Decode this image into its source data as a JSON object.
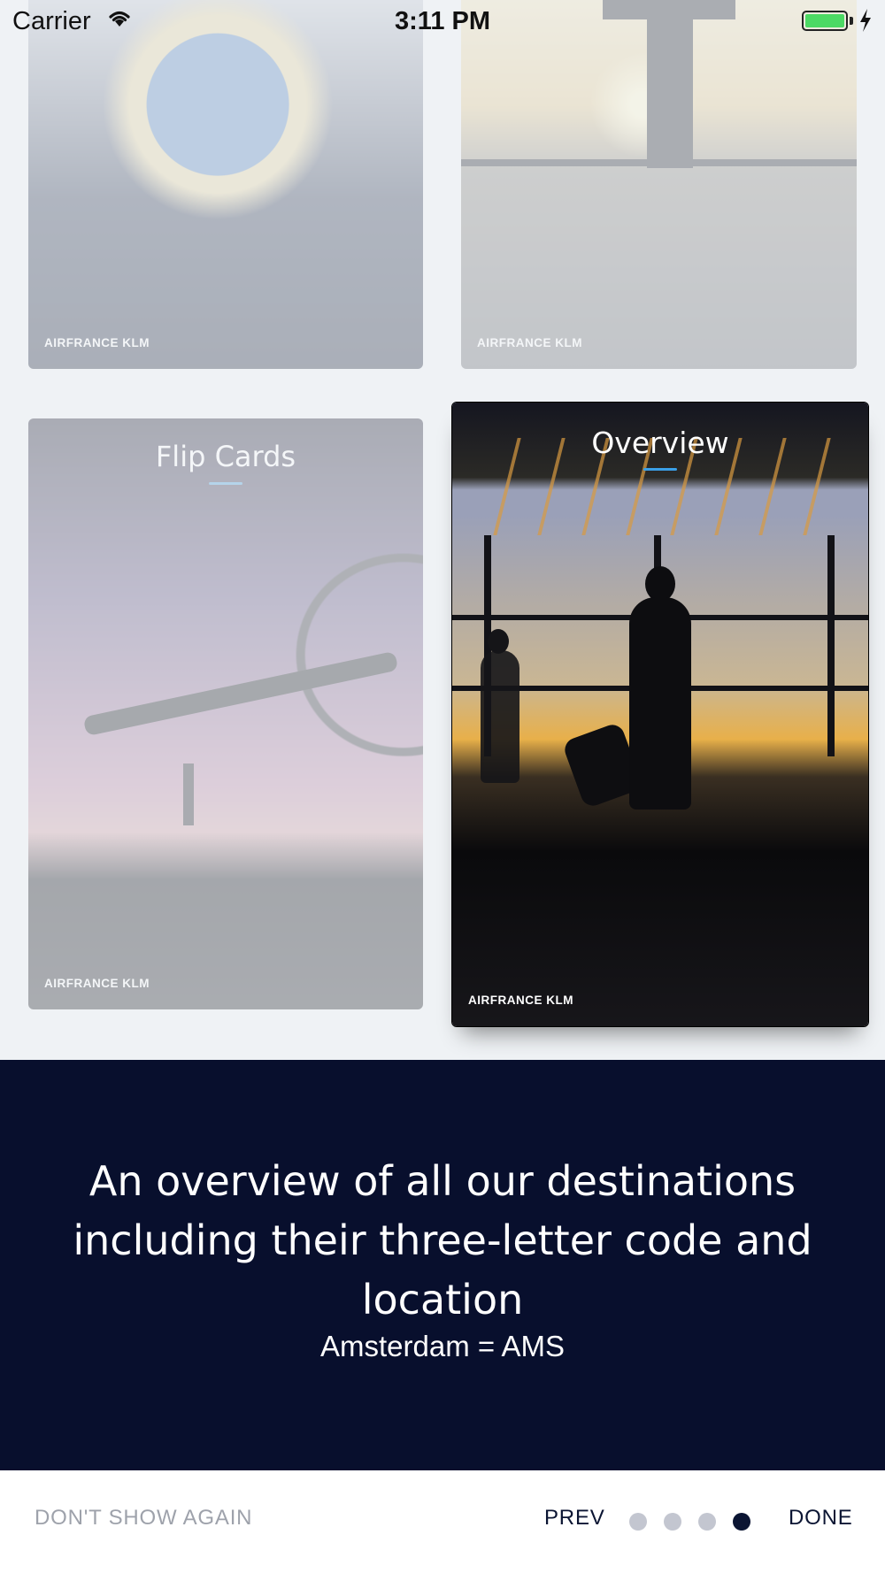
{
  "status_bar": {
    "carrier": "Carrier",
    "time": "3:11 PM",
    "battery_color": "#4cd964"
  },
  "cards": [
    {
      "title": "",
      "brand": "AIRFRANCE KLM",
      "active": false
    },
    {
      "title": "",
      "brand": "AIRFRANCE KLM",
      "active": false
    },
    {
      "title": "Flip Cards",
      "brand": "AIRFRANCE KLM",
      "active": false
    },
    {
      "title": "Overview",
      "brand": "AIRFRANCE KLM",
      "active": true
    }
  ],
  "info": {
    "headline": "An overview of all our destinations including their three-letter code and location",
    "subline": "Amsterdam = AMS"
  },
  "footer": {
    "dont_show_label": "DON'T SHOW AGAIN",
    "prev_label": "PREV",
    "done_label": "DONE",
    "page_count": 4,
    "current_page": 4
  },
  "colors": {
    "panel_bg": "#080f2d",
    "accent": "#3aa0e8",
    "dot_inactive": "#c3c6d0",
    "dot_active": "#0b1533"
  }
}
